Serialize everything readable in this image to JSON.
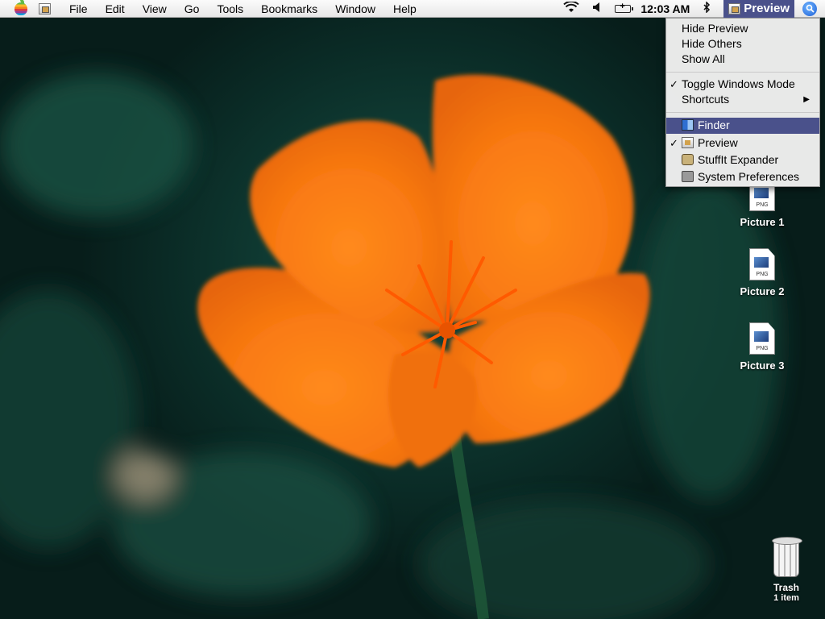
{
  "menubar": {
    "apple_icon": "apple-logo-icon",
    "app_icon": "preview-app-icon",
    "menus": [
      "File",
      "Edit",
      "View",
      "Go",
      "Tools",
      "Bookmarks",
      "Window",
      "Help"
    ],
    "status": {
      "wifi_icon": "wifi-icon",
      "volume_icon": "volume-icon",
      "battery_icon": "battery-icon",
      "clock": "12:03 AM",
      "bluetooth_icon": "bluetooth-icon"
    },
    "active_app": "Preview",
    "spotlight_icon": "spotlight-icon"
  },
  "app_switcher_menu": {
    "section1": [
      "Hide Preview",
      "Hide Others",
      "Show All"
    ],
    "toggle_windows_mode": "Toggle Windows Mode",
    "shortcuts": "Shortcuts",
    "apps": [
      {
        "label": "Finder",
        "icon": "finder-icon",
        "checked": false,
        "highlighted": true
      },
      {
        "label": "Preview",
        "icon": "preview-icon",
        "checked": true,
        "highlighted": false
      },
      {
        "label": "StuffIt Expander",
        "icon": "stuffit-icon",
        "checked": false,
        "highlighted": false
      },
      {
        "label": "System Preferences",
        "icon": "system-preferences-icon",
        "checked": false,
        "highlighted": false
      }
    ],
    "highlight_color": "#4a518b"
  },
  "desktop": {
    "icons": [
      {
        "label": "Picture 1",
        "type": "PNG"
      },
      {
        "label": "Picture 2",
        "type": "PNG"
      },
      {
        "label": "Picture 3",
        "type": "PNG"
      }
    ],
    "trash": {
      "label": "Trash",
      "sublabel": "1 item"
    }
  }
}
